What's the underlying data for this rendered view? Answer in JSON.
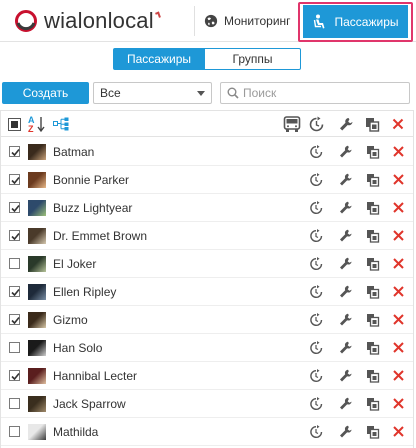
{
  "header": {
    "logo_text": "wialonlocal",
    "nav_monitoring": "Мониторинг",
    "nav_passengers": "Пассажиры"
  },
  "tabs": {
    "active": "Пассажиры",
    "inactive": "Группы"
  },
  "toolbar": {
    "create_label": "Создать",
    "filter_value": "Все",
    "search_placeholder": "Поиск"
  },
  "list_header": {
    "sort_az_label": "A↓Z"
  },
  "rows": [
    {
      "name": "Batman",
      "checked": true,
      "thumb": [
        "#3a2a1c",
        "#c9a27a"
      ]
    },
    {
      "name": "Bonnie Parker",
      "checked": true,
      "thumb": [
        "#6b3a1e",
        "#e8b98a"
      ]
    },
    {
      "name": "Buzz Lightyear",
      "checked": true,
      "thumb": [
        "#2d4a6b",
        "#9fc27a"
      ]
    },
    {
      "name": "Dr. Emmet Brown",
      "checked": true,
      "thumb": [
        "#4a3a2a",
        "#d6c9b0"
      ]
    },
    {
      "name": "El Joker",
      "checked": false,
      "thumb": [
        "#2a3a2a",
        "#b7c49a"
      ]
    },
    {
      "name": "Ellen Ripley",
      "checked": true,
      "thumb": [
        "#1e2a3a",
        "#7a8fa6"
      ]
    },
    {
      "name": "Gizmo",
      "checked": true,
      "thumb": [
        "#3a2a1a",
        "#d8c8a8"
      ]
    },
    {
      "name": "Han Solo",
      "checked": false,
      "thumb": [
        "#1a1a1a",
        "#cfcfcf"
      ]
    },
    {
      "name": "Hannibal Lecter",
      "checked": true,
      "thumb": [
        "#5a1e1e",
        "#e0c0a0"
      ]
    },
    {
      "name": "Jack Sparrow",
      "checked": false,
      "thumb": [
        "#3a2e1e",
        "#a08a6a"
      ]
    },
    {
      "name": "Mathilda",
      "checked": false,
      "thumb": [
        "#e8e8e8",
        "#3a3a3a"
      ]
    }
  ],
  "colors": {
    "accent": "#1e98d7",
    "highlight_outline": "#e0356b",
    "delete": "#e0352b",
    "icon": "#555555"
  }
}
